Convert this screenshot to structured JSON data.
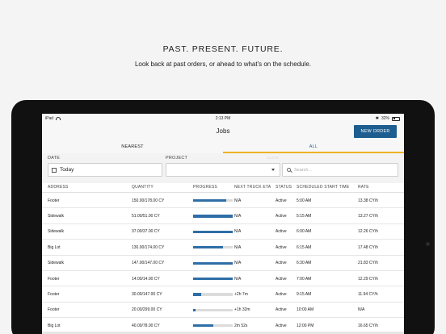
{
  "promo": {
    "headline": "PAST. PRESENT. FUTURE.",
    "subline": "Look back at past orders, or ahead to what's on the schedule."
  },
  "status_bar": {
    "device": "iPad",
    "time": "2:13 PM",
    "battery": "32%",
    "battery_level": 0.32
  },
  "nav": {
    "title": "Jobs",
    "new_order_label": "NEW ORDER"
  },
  "tabs": [
    {
      "label": "NEAREST",
      "active": false
    },
    {
      "label": "ALL",
      "active": true
    }
  ],
  "filters": {
    "date_label": "DATE",
    "date_value": "Today",
    "project_label": "PROJECT",
    "project_value": "",
    "clear_label": "CLEAR",
    "search_placeholder": "Search..."
  },
  "table": {
    "columns": [
      "ADDRESS",
      "QUANTITY",
      "PROGRESS",
      "NEXT TRUCK ETA",
      "STATUS",
      "SCHEDULED START TIME",
      "RATE"
    ],
    "rows": [
      {
        "address": "Footer",
        "quantity": "150.00/178.00 CY",
        "progress": 0.84,
        "eta": "N/A",
        "status": "Active",
        "start": "5:00 AM",
        "rate": "13.38 CY/h"
      },
      {
        "address": "Sidewalk",
        "quantity": "51.00/51.00 CY",
        "progress": 1.0,
        "eta": "N/A",
        "status": "Active",
        "start": "5:15 AM",
        "rate": "13.27 CY/h"
      },
      {
        "address": "Sidewalk",
        "quantity": "37.00/37.00 CY",
        "progress": 1.0,
        "eta": "N/A",
        "status": "Active",
        "start": "6:00 AM",
        "rate": "12.26 CY/h"
      },
      {
        "address": "Big Lot",
        "quantity": "130.00/174.00 CY",
        "progress": 0.75,
        "eta": "N/A",
        "status": "Active",
        "start": "6:15 AM",
        "rate": "17.48 CY/h"
      },
      {
        "address": "Sidewalk",
        "quantity": "147.00/147.00 CY",
        "progress": 1.0,
        "eta": "N/A",
        "status": "Active",
        "start": "6:30 AM",
        "rate": "21.83 CY/h"
      },
      {
        "address": "Footer",
        "quantity": "14.00/14.00 CY",
        "progress": 1.0,
        "eta": "N/A",
        "status": "Active",
        "start": "7:00 AM",
        "rate": "12.29 CY/h"
      },
      {
        "address": "Footer",
        "quantity": "30.00/147.00 CY",
        "progress": 0.2,
        "eta": "+2h 7m",
        "status": "Active",
        "start": "9:15 AM",
        "rate": "11.94 CY/h"
      },
      {
        "address": "Footer",
        "quantity": "20.00/299.00 CY",
        "progress": 0.07,
        "eta": "+1h 32m",
        "status": "Active",
        "start": "10:00 AM",
        "rate": "N/A"
      },
      {
        "address": "Big Lot",
        "quantity": "40.00/78.00 CY",
        "progress": 0.51,
        "eta": "2m 52s",
        "status": "Active",
        "start": "12:00 PM",
        "rate": "16.65 CY/h"
      }
    ]
  }
}
